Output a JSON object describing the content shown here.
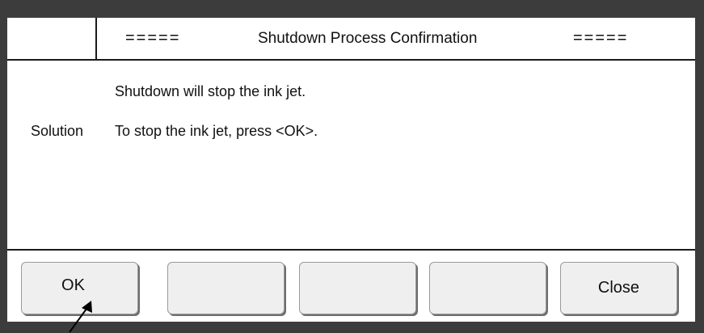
{
  "title": {
    "left_marks": "=====",
    "text": "Shutdown Process Confirmation",
    "right_marks": "====="
  },
  "message": {
    "line": "Shutdown will stop the ink jet.",
    "solution_label": "Solution",
    "solution_text": "To stop the ink jet, press <OK>."
  },
  "buttons": {
    "b1": "OK",
    "b2": "",
    "b3": "",
    "b4": "",
    "b5": "Close"
  },
  "colors": {
    "frame": "#3c3c3c",
    "button_face": "#efefef"
  }
}
